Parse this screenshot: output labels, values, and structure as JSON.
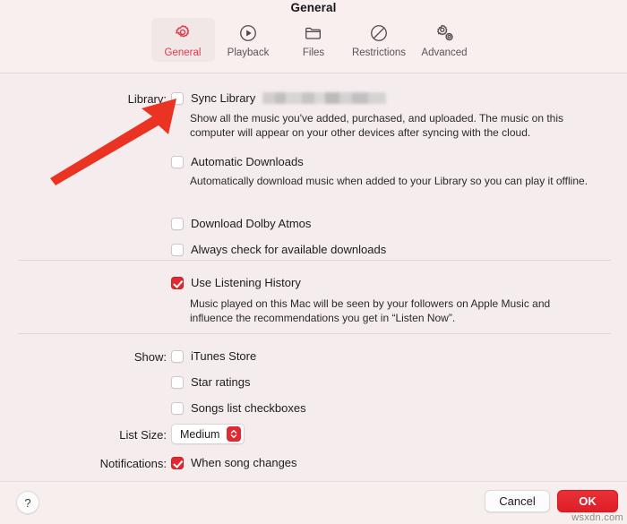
{
  "window": {
    "title": "General"
  },
  "toolbar": {
    "tabs": [
      {
        "label": "General",
        "icon": "gear-icon",
        "selected": true
      },
      {
        "label": "Playback",
        "icon": "play-circle-icon",
        "selected": false
      },
      {
        "label": "Files",
        "icon": "folder-icon",
        "selected": false
      },
      {
        "label": "Restrictions",
        "icon": "no-entry-icon",
        "selected": false
      },
      {
        "label": "Advanced",
        "icon": "double-gear-icon",
        "selected": false
      }
    ]
  },
  "sections": {
    "library": {
      "label": "Library:",
      "sync_library": {
        "label": "Sync Library",
        "checked": false,
        "account_redacted": true
      },
      "sync_library_desc": "Show all the music you've added, purchased, and uploaded. The music on this computer will appear on your other devices after syncing with the cloud.",
      "automatic_downloads": {
        "label": "Automatic Downloads",
        "checked": false
      },
      "automatic_downloads_desc": "Automatically download music when added to your Library so you can play it offline.",
      "download_dolby_atmos": {
        "label": "Download Dolby Atmos",
        "checked": false
      },
      "always_check_downloads": {
        "label": "Always check for available downloads",
        "checked": false
      }
    },
    "listening_history": {
      "use_listening_history": {
        "label": "Use Listening History",
        "checked": true
      },
      "description": "Music played on this Mac will be seen by your followers on Apple Music and influence the recommendations you get in “Listen Now”."
    },
    "show": {
      "label": "Show:",
      "itunes_store": {
        "label": "iTunes Store",
        "checked": false
      },
      "star_ratings": {
        "label": "Star ratings",
        "checked": false
      },
      "songs_list_checkboxes": {
        "label": "Songs list checkboxes",
        "checked": false
      }
    },
    "list_size": {
      "label": "List Size:",
      "value": "Medium"
    },
    "notifications": {
      "label": "Notifications:",
      "when_song_changes": {
        "label": "When song changes",
        "checked": true
      }
    }
  },
  "footer": {
    "help_label": "?",
    "cancel_label": "Cancel",
    "ok_label": "OK"
  },
  "watermark": "wsxdn.com",
  "annotation": {
    "arrow_color": "#ea3323",
    "points_to": "sync-library-checkbox"
  },
  "colors": {
    "accent_red": "#e02a32",
    "window_background": "#f5eded",
    "toolbar_background": "#faefef",
    "selected_tab_text": "#e03a4e"
  }
}
